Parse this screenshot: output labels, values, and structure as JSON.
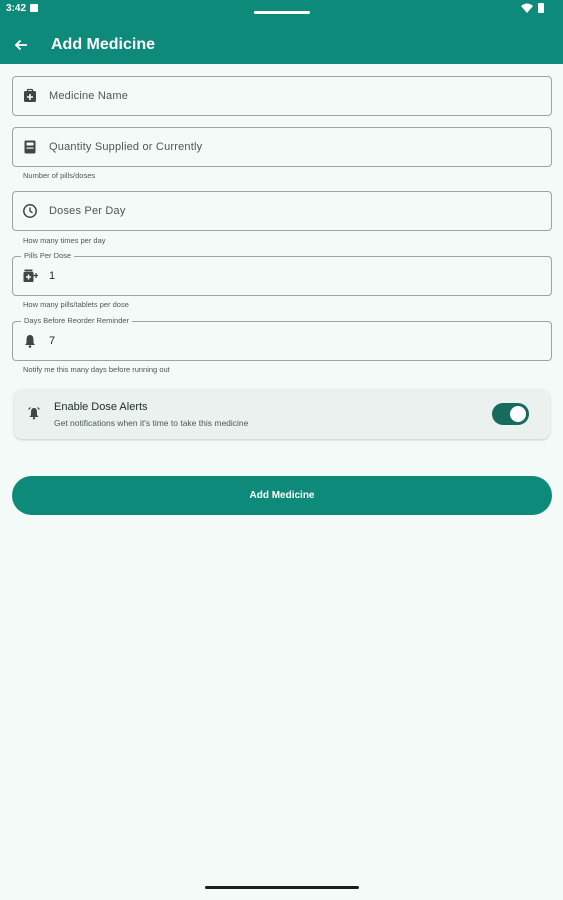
{
  "status_bar": {
    "time": "3:42"
  },
  "header": {
    "title": "Add Medicine",
    "back_icon": "arrow-back-icon"
  },
  "colors": {
    "primary": "#0e8a7a",
    "toggle_on": "#176b5e",
    "background": "#f3faf8"
  },
  "form": {
    "medicine_name": {
      "placeholder": "Medicine Name",
      "icon": "medical-bag-icon"
    },
    "quantity": {
      "placeholder": "Quantity Supplied or Currently",
      "helper": "Number of pills/doses",
      "icon": "calculator-icon"
    },
    "doses_per_day": {
      "placeholder": "Doses Per Day",
      "helper": "How many times per day",
      "icon": "clock-icon"
    },
    "pills_per_dose": {
      "label": "Pills Per Dose",
      "value": "1",
      "helper": "How many pills/tablets per dose",
      "icon": "medication-add-icon"
    },
    "reorder_days": {
      "label": "Days Before Reorder Reminder",
      "value": "7",
      "helper": "Notify me this many days before running out",
      "icon": "bell-icon"
    }
  },
  "alerts": {
    "title": "Enable Dose Alerts",
    "subtitle": "Get notifications when it's time to take this medicine",
    "enabled": true,
    "icon": "alarm-bell-icon"
  },
  "submit": {
    "label": "Add Medicine"
  }
}
